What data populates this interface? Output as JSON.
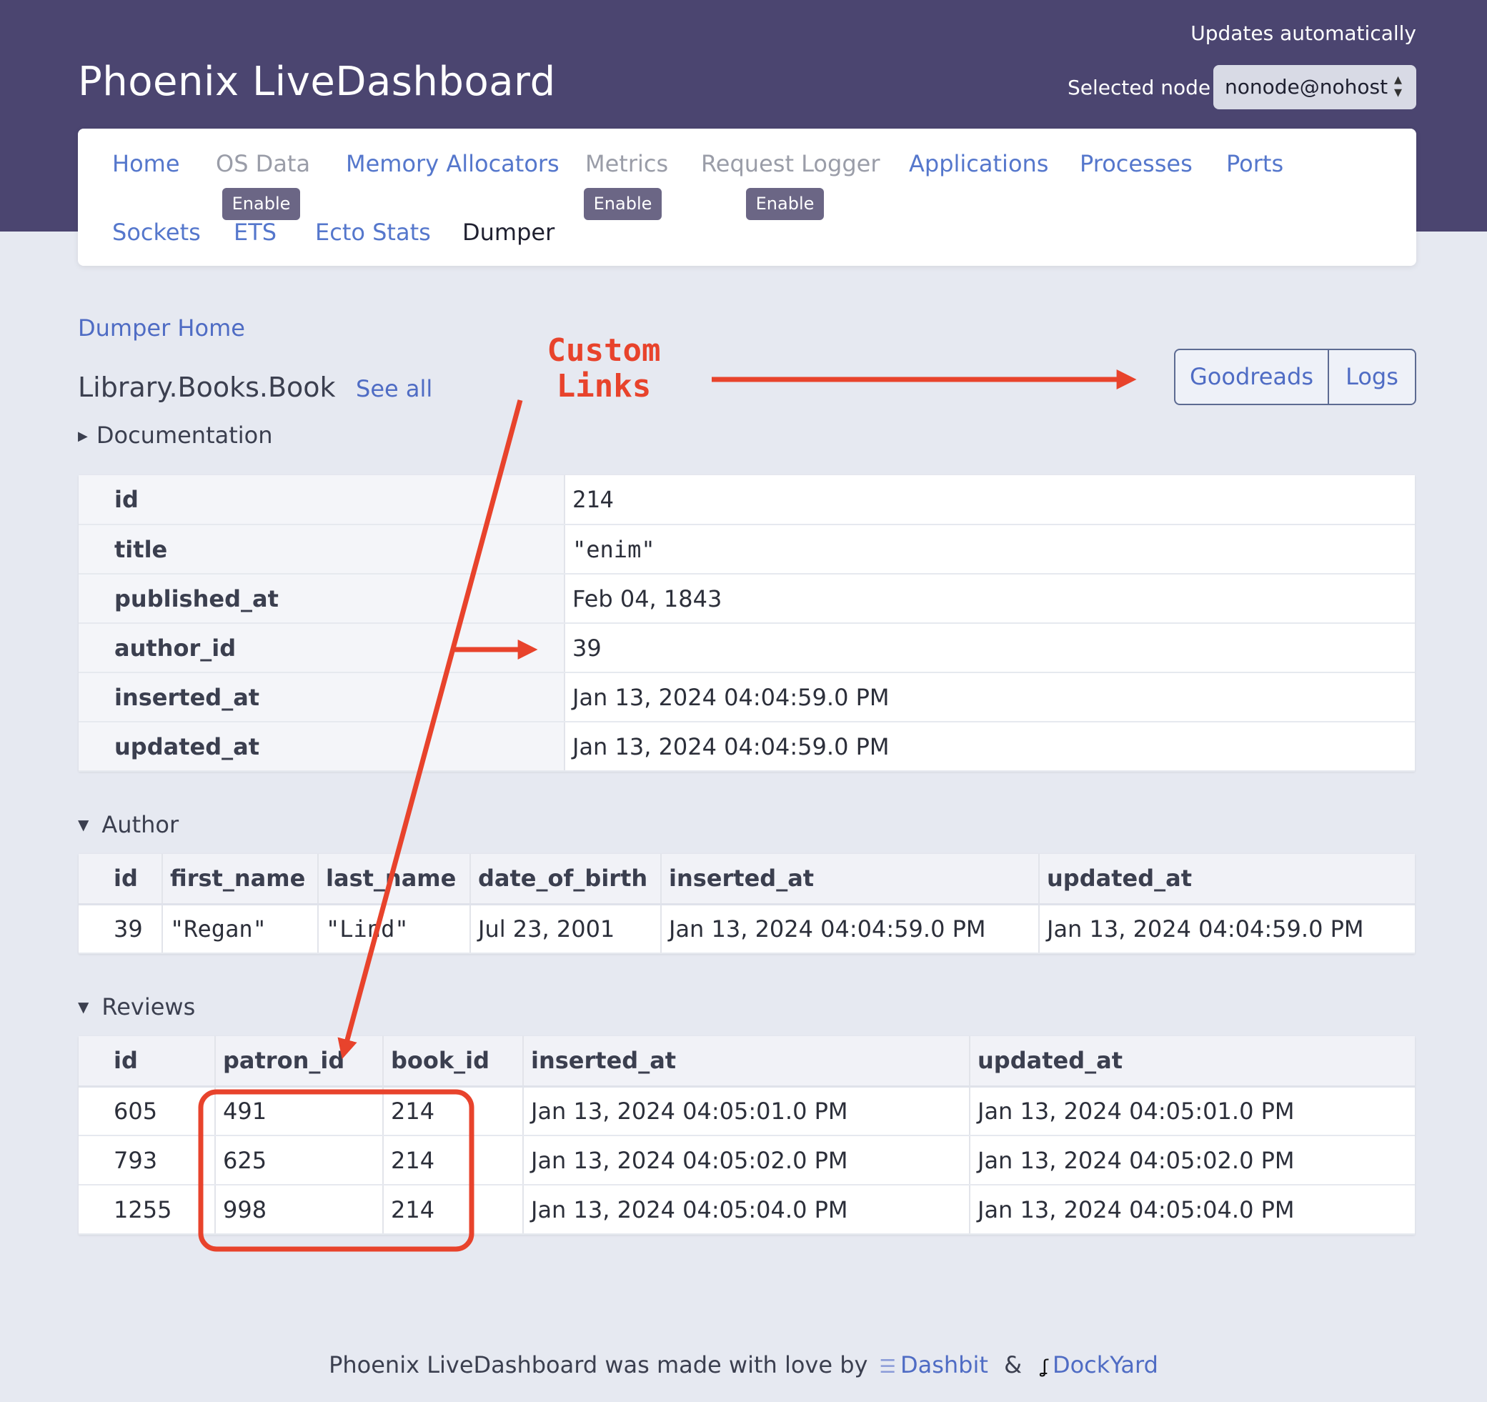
{
  "header": {
    "brand": "Phoenix LiveDashboard",
    "updates": "Updates automatically",
    "node_label": "Selected node",
    "node_value": "nonode@nohost"
  },
  "nav": {
    "home": "Home",
    "os_data": "OS Data",
    "memory_allocators": "Memory Allocators",
    "metrics": "Metrics",
    "request_logger": "Request Logger",
    "applications": "Applications",
    "processes": "Processes",
    "ports": "Ports",
    "sockets": "Sockets",
    "ets": "ETS",
    "ecto_stats": "Ecto Stats",
    "dumper": "Dumper",
    "enable_label": "Enable"
  },
  "page": {
    "dumper_home": "Dumper Home",
    "schema": "Library.Books.Book",
    "see_all": "See all",
    "documentation": "Documentation",
    "custom_buttons": [
      "Goodreads",
      "Logs"
    ]
  },
  "annotation": {
    "line1": "Custom",
    "line2": "Links",
    "color": "#e8432c"
  },
  "record": [
    {
      "key": "id",
      "value": "214"
    },
    {
      "key": "title",
      "value": "\"enim\""
    },
    {
      "key": "published_at",
      "value": "Feb 04, 1843"
    },
    {
      "key": "author_id",
      "value": "39"
    },
    {
      "key": "inserted_at",
      "value": "Jan 13, 2024   04:04:59.0 PM"
    },
    {
      "key": "updated_at",
      "value": "Jan 13, 2024   04:04:59.0 PM"
    }
  ],
  "author": {
    "title": "Author",
    "columns": [
      "id",
      "first_name",
      "last_name",
      "date_of_birth",
      "inserted_at",
      "updated_at"
    ],
    "rows": [
      [
        "39",
        "\"Regan\"",
        "\"Lind\"",
        "Jul 23, 2001",
        "Jan 13, 2024   04:04:59.0 PM",
        "Jan 13, 2024   04:04:59.0 PM"
      ]
    ]
  },
  "reviews": {
    "title": "Reviews",
    "columns": [
      "id",
      "patron_id",
      "book_id",
      "inserted_at",
      "updated_at"
    ],
    "rows": [
      [
        "605",
        "491",
        "214",
        "Jan 13, 2024   04:05:01.0 PM",
        "Jan 13, 2024   04:05:01.0 PM"
      ],
      [
        "793",
        "625",
        "214",
        "Jan 13, 2024   04:05:02.0 PM",
        "Jan 13, 2024   04:05:02.0 PM"
      ],
      [
        "1255",
        "998",
        "214",
        "Jan 13, 2024   04:05:04.0 PM",
        "Jan 13, 2024   04:05:04.0 PM"
      ]
    ]
  },
  "footer": {
    "text": "Phoenix LiveDashboard was made with love by",
    "dashbit": "Dashbit",
    "amp": "&",
    "dockyard": "DockYard"
  },
  "colors": {
    "header_bg": "#4b4570",
    "link": "#4f6cc4",
    "annotation": "#e8432c"
  }
}
